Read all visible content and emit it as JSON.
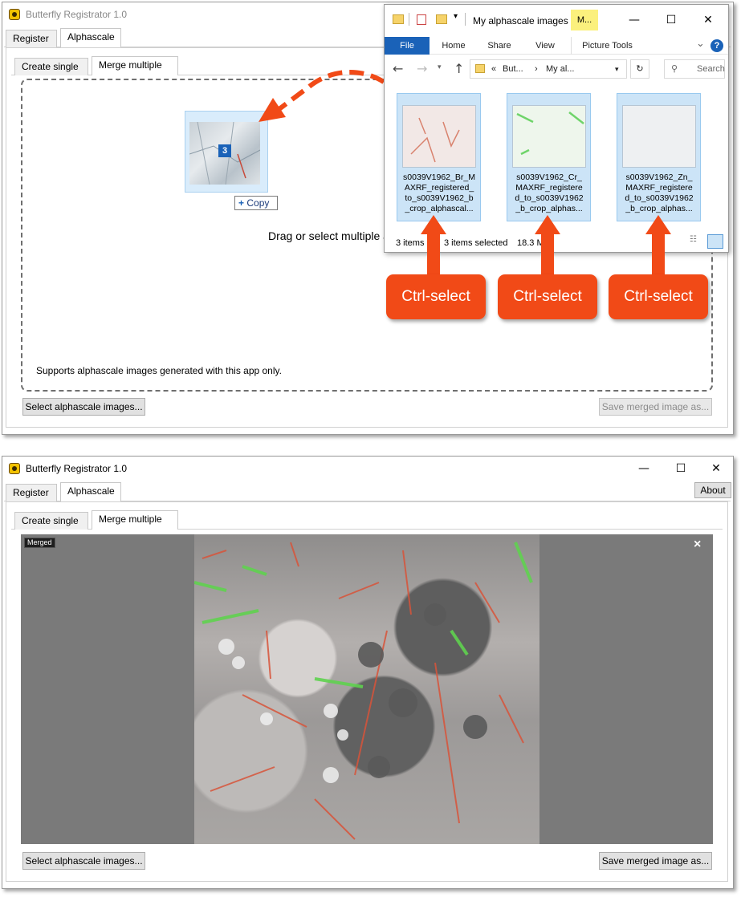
{
  "top_window": {
    "title": "Butterfly Registrator 1.0",
    "tabs": [
      "Register",
      "Alphascale"
    ],
    "subtabs": [
      "Create single",
      "Merge multiple"
    ],
    "drop_text": "Drag or select multiple a",
    "support_note": "Supports alphascale images generated with this app only.",
    "select_button": "Select alphascale images...",
    "save_button": "Save merged image as...",
    "drag_count": "3",
    "copy_label": "Copy"
  },
  "explorer": {
    "title": "My alphascale images",
    "title_tab": "M...",
    "ribbon_tabs": [
      "File",
      "Home",
      "Share",
      "View",
      "Picture Tools"
    ],
    "breadcrumb_prefix": "«",
    "breadcrumb_parts": [
      "But...",
      "My al..."
    ],
    "search_placeholder": "Search",
    "files": [
      {
        "name_lines": [
          "s0039V1962_Br_M",
          "AXRF_registered_",
          "to_s0039V1962_b",
          "_crop_alphascal..."
        ]
      },
      {
        "name_lines": [
          "s0039V1962_Cr_",
          "MAXRF_registere",
          "d_to_s0039V1962",
          "_b_crop_alphas..."
        ]
      },
      {
        "name_lines": [
          "s0039V1962_Zn_",
          "MAXRF_registere",
          "d_to_s0039V1962",
          "_b_crop_alphas..."
        ]
      }
    ],
    "status_items": "3 items",
    "status_selected": "3 items selected",
    "status_size": "18.3 M"
  },
  "callouts": [
    "Ctrl-select",
    "Ctrl-select",
    "Ctrl-select"
  ],
  "bottom_window": {
    "title": "Butterfly Registrator 1.0",
    "tabs": [
      "Register",
      "Alphascale"
    ],
    "about_button": "About",
    "subtabs": [
      "Create single",
      "Merge multiple"
    ],
    "merged_label": "Merged",
    "close_glyph": "×",
    "select_button": "Select alphascale images...",
    "save_button": "Save merged image as..."
  },
  "window_glyphs": {
    "minimize": "—",
    "maximize": "☐",
    "close": "✕",
    "chevron": "⌄",
    "help": "?"
  },
  "colors": {
    "accent": "#f14a17",
    "file_tab": "#1a62b8",
    "selection": "#cce4f7"
  }
}
